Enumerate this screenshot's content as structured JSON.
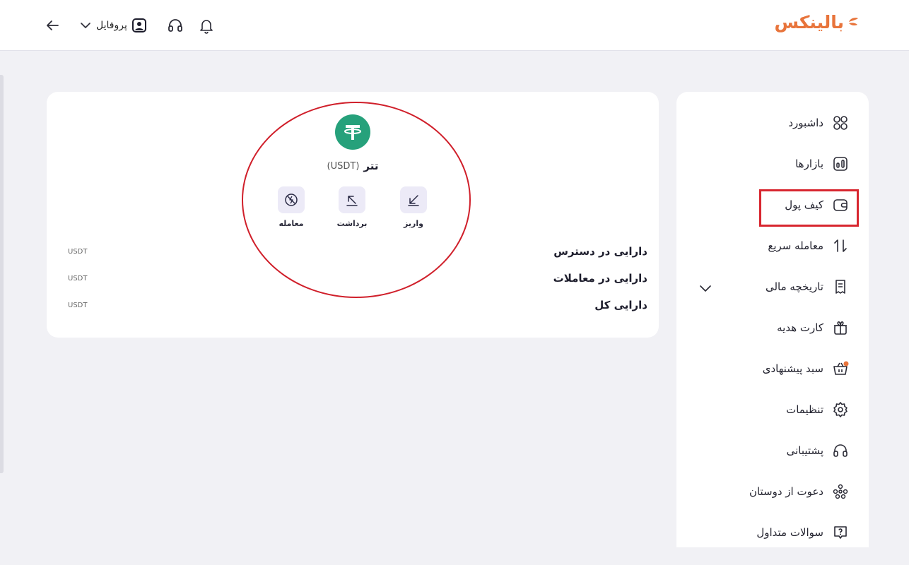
{
  "header": {
    "logo_text": "بالینکس",
    "profile_label": "پروفایل",
    "brand_color": "#e8743b",
    "icons": [
      "arrow-left-icon",
      "chevron-down-icon",
      "user-icon",
      "headset-icon",
      "bell-icon"
    ]
  },
  "sidebar": {
    "items": [
      {
        "label": "داشبورد",
        "icon": "dashboard-grid-icon"
      },
      {
        "label": "بازارها",
        "icon": "markets-chart-icon"
      },
      {
        "label": "کیف پول",
        "icon": "wallet-icon",
        "active": true
      },
      {
        "label": "معامله سریع",
        "icon": "swap-arrows-icon"
      },
      {
        "label": "تاریخچه مالی",
        "icon": "receipt-icon",
        "expandable": true
      },
      {
        "label": "کارت هدیه",
        "icon": "gift-icon"
      },
      {
        "label": "سبد پیشنهادی",
        "icon": "basket-icon",
        "badge_color": "#e8743b"
      },
      {
        "label": "تنظیمات",
        "icon": "gear-icon"
      },
      {
        "label": "پشتیبانی",
        "icon": "headset-icon"
      },
      {
        "label": "دعوت از دوستان",
        "icon": "users-icon"
      },
      {
        "label": "سوالات متداول",
        "icon": "question-bubble-icon"
      }
    ]
  },
  "coin": {
    "name": "تتر",
    "symbol": "(USDT)",
    "logo_color": "#26a17b",
    "actions": [
      {
        "label": "واریز",
        "icon": "deposit-arrow-icon"
      },
      {
        "label": "برداشت",
        "icon": "withdraw-arrow-icon"
      },
      {
        "label": "معامله",
        "icon": "trade-slash-icon"
      }
    ]
  },
  "balances": [
    {
      "label": "دارایی در دسترس",
      "unit": "USDT"
    },
    {
      "label": "دارایی در معاملات",
      "unit": "USDT"
    },
    {
      "label": "دارایی کل",
      "unit": "USDT"
    }
  ],
  "annotation_color": "#d01f2a"
}
